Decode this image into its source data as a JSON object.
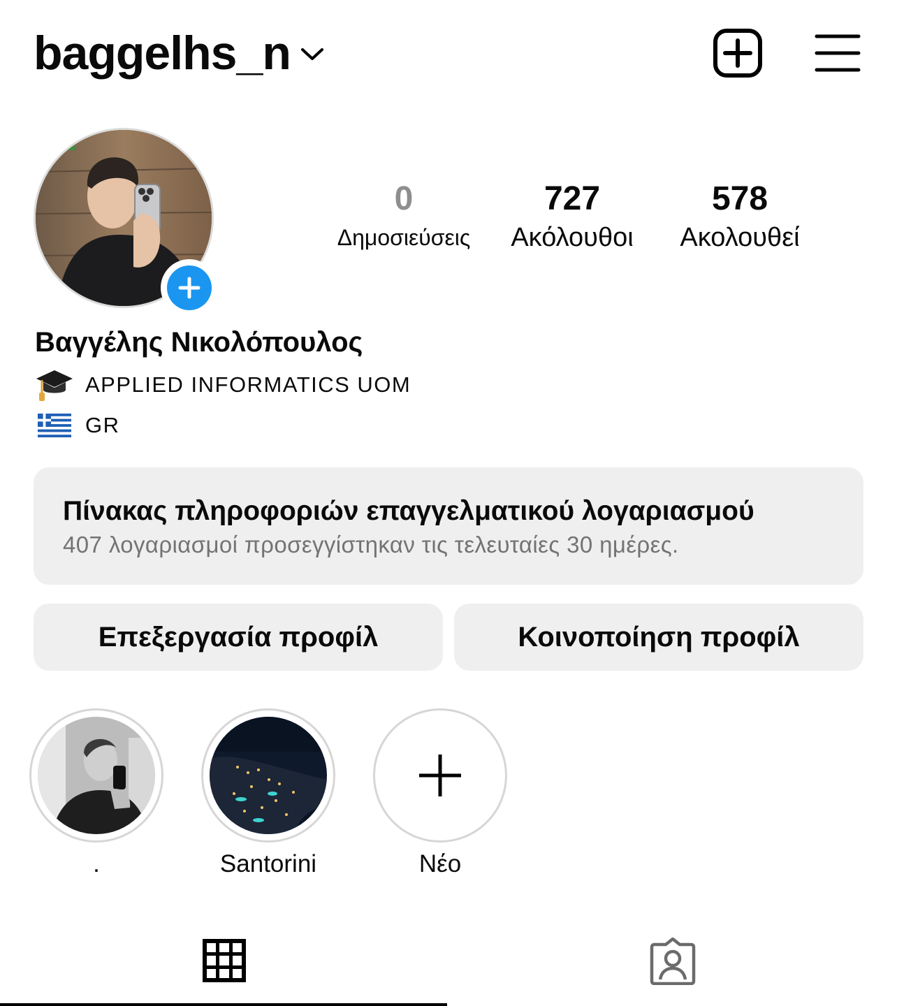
{
  "header": {
    "username": "baggelhs_n",
    "icons": {
      "dropdown": "chevron-down-icon",
      "create": "plus-square-icon",
      "menu": "hamburger-menu-icon"
    }
  },
  "profile": {
    "stats": {
      "posts": {
        "value": "0",
        "label": "Δημοσιεύσεις"
      },
      "followers": {
        "value": "727",
        "label": "Ακόλουθοι"
      },
      "following": {
        "value": "578",
        "label": "Ακολουθεί"
      }
    },
    "full_name": "Βαγγέλης Νικολόπουλος",
    "bio": [
      {
        "icon": "graduation-cap-icon",
        "text": "APPLIED INFORMATICS UOM"
      },
      {
        "icon": "greek-flag-icon",
        "text": "GR"
      }
    ]
  },
  "dashboard": {
    "title": "Πίνακας πληροφοριών επαγγελματικού λογαριασμού",
    "subtitle": "407 λογαριασμοί προσεγγίστηκαν τις τελευταίες 30 ημέρες."
  },
  "buttons": {
    "edit_profile": "Επεξεργασία προφίλ",
    "share_profile": "Κοινοποίηση προφίλ"
  },
  "highlights": [
    {
      "label": "."
    },
    {
      "label": "Santorini"
    },
    {
      "label": "Νέο"
    }
  ],
  "tabs": {
    "active": "posts-grid",
    "items": [
      "grid-icon",
      "tagged-person-icon"
    ]
  },
  "colors": {
    "accent_blue": "#1a96f0",
    "muted_gray": "#737373",
    "surface": "#efefef"
  }
}
